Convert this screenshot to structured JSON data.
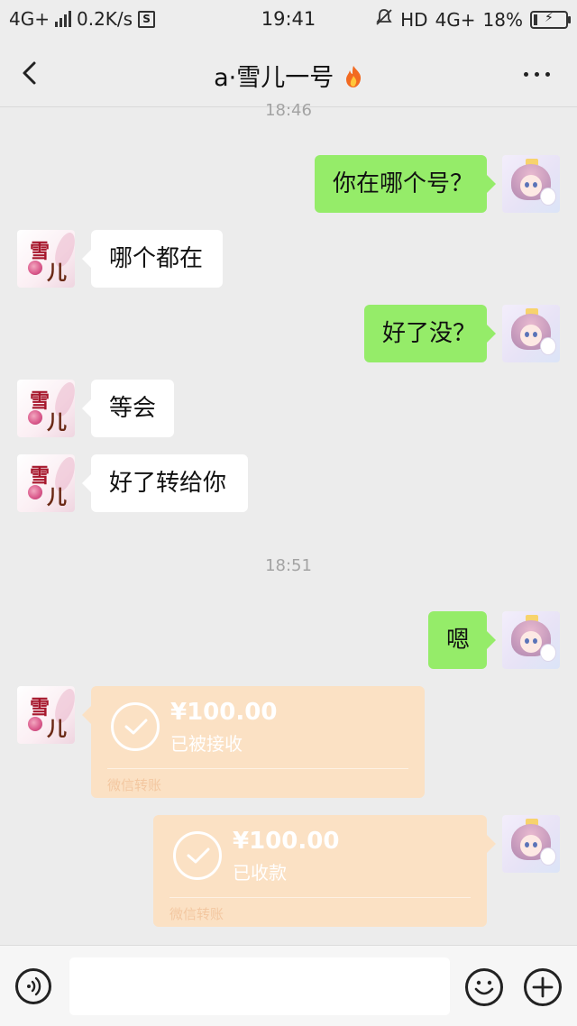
{
  "status_bar": {
    "network": "4G+",
    "speed": "0.2K/s",
    "s_icon": "S",
    "time": "19:41",
    "hd": "HD",
    "network_right": "4G+",
    "battery": "18%"
  },
  "header": {
    "title": "a·雪儿一号",
    "back_icon": "chevron-left-icon",
    "more_icon": "more-dots-icon",
    "title_icon": "fire-icon"
  },
  "timestamps": {
    "top_partial": "18:46",
    "middle": "18:51"
  },
  "messages": [
    {
      "sender": "self",
      "text": "你在哪个号？"
    },
    {
      "sender": "other",
      "text": "哪个都在"
    },
    {
      "sender": "self",
      "text": "好了没？"
    },
    {
      "sender": "other",
      "text": "等会"
    },
    {
      "sender": "other",
      "text": "好了转给你"
    },
    {
      "sender": "self",
      "text": "嗯"
    }
  ],
  "avatars": {
    "other_text_1": "雪",
    "other_text_2": "儿"
  },
  "transfers": [
    {
      "sender": "other",
      "amount": "¥100.00",
      "status": "已被接收",
      "footer": "微信转账"
    },
    {
      "sender": "self",
      "amount": "¥100.00",
      "status": "已收款",
      "footer": "微信转账"
    }
  ],
  "input_bar": {
    "value": "",
    "voice_icon": "voice-icon",
    "emoji_icon": "emoji-icon",
    "plus_icon": "plus-icon"
  },
  "colors": {
    "self_bubble": "#95ec69",
    "other_bubble": "#ffffff",
    "transfer_card": "#fbe1c4",
    "background": "#ececec"
  }
}
